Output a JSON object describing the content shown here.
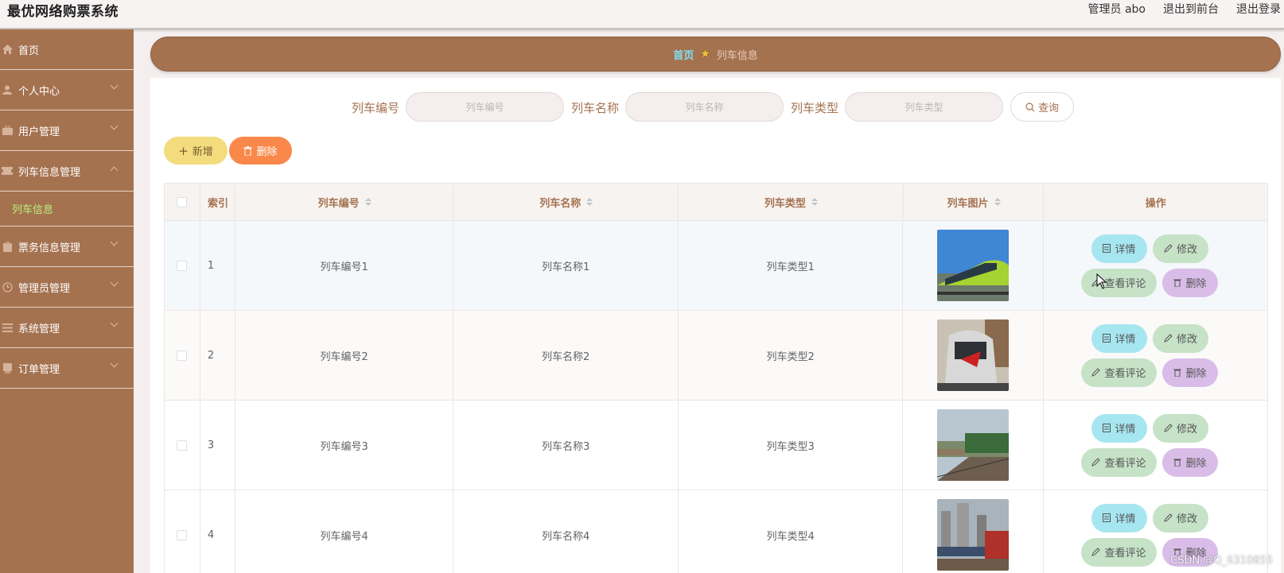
{
  "header": {
    "title": "最优网络购票系统",
    "admin_label": "管理员 abo",
    "goto_front": "退出到前台",
    "logout": "退出登录"
  },
  "sidebar": {
    "items": [
      {
        "label": "首页",
        "icon": "home-icon"
      },
      {
        "label": "个人中心",
        "icon": "user-icon"
      },
      {
        "label": "用户管理",
        "icon": "briefcase-icon"
      },
      {
        "label": "列车信息管理",
        "icon": "ticket-icon"
      },
      {
        "label": "票务信息管理",
        "icon": "clipboard-icon"
      },
      {
        "label": "管理员管理",
        "icon": "clock-icon"
      },
      {
        "label": "系统管理",
        "icon": "list-icon"
      },
      {
        "label": "订单管理",
        "icon": "document-icon"
      }
    ],
    "sub_item": "列车信息"
  },
  "breadcrumb": {
    "home": "首页",
    "current": "列车信息"
  },
  "search": {
    "train_no_label": "列车编号",
    "train_no_placeholder": "列车编号",
    "train_name_label": "列车名称",
    "train_name_placeholder": "列车名称",
    "train_type_label": "列车类型",
    "train_type_placeholder": "列车类型",
    "query_button": "查询"
  },
  "actions": {
    "add": "新增",
    "delete": "删除"
  },
  "table": {
    "headers": {
      "index": "索引",
      "train_no": "列车编号",
      "train_name": "列车名称",
      "train_type": "列车类型",
      "train_image": "列车图片",
      "operations": "操作"
    },
    "row_buttons": {
      "detail": "详情",
      "edit": "修改",
      "comments": "查看评论",
      "delete": "删除"
    },
    "rows": [
      {
        "index": "1",
        "train_no": "列车编号1",
        "train_name": "列车名称1",
        "train_type": "列车类型1"
      },
      {
        "index": "2",
        "train_no": "列车编号2",
        "train_name": "列车名称2",
        "train_type": "列车类型2"
      },
      {
        "index": "3",
        "train_no": "列车编号3",
        "train_name": "列车名称3",
        "train_type": "列车类型3"
      },
      {
        "index": "4",
        "train_no": "列车编号4",
        "train_name": "列车名称4",
        "train_type": "列车类型4"
      }
    ]
  },
  "watermark": "CSDN @Q_6310855",
  "colors": {
    "sidebar": "#a57250",
    "accent_text": "#a57250",
    "active_submenu": "#b9f27c",
    "add_button": "#f2dc7e",
    "delete_button": "#f9884a",
    "detail_button": "#a6e6f0",
    "edit_button": "#c6e2c7",
    "remove_button": "#d9bde8"
  }
}
